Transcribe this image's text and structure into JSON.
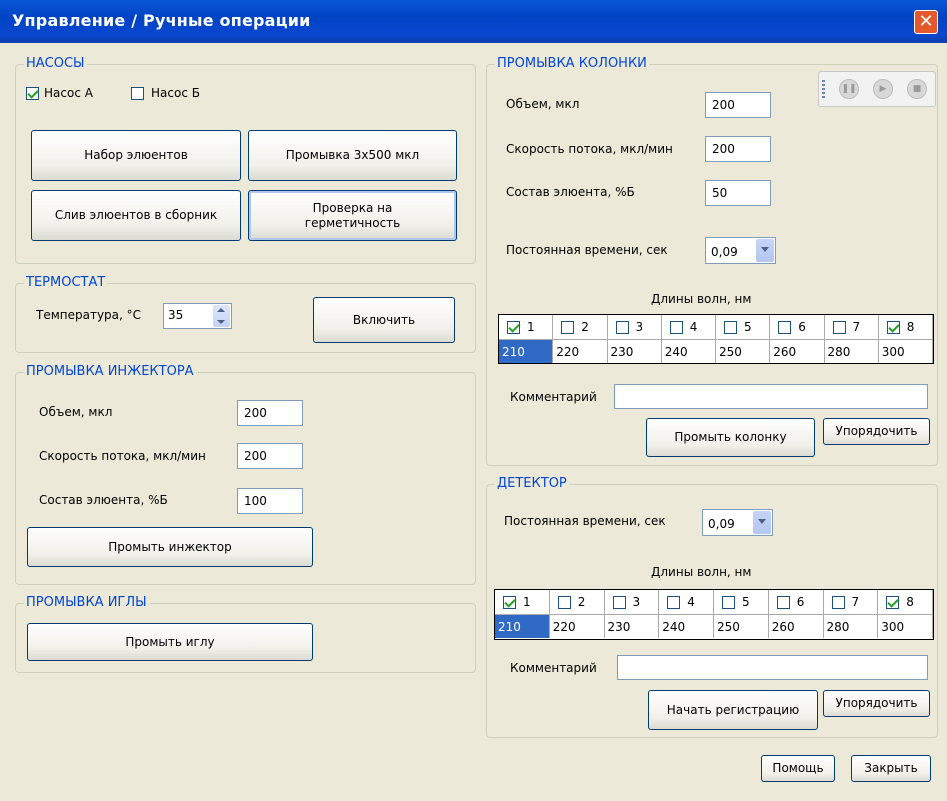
{
  "window": {
    "title": "Управление / Ручные операции"
  },
  "pumps": {
    "legend": "НАСОСЫ",
    "pump_a": {
      "label": "Насос А",
      "checked": true
    },
    "pump_b": {
      "label": "Насос Б",
      "checked": false
    },
    "btn_eluent_fill": "Набор элюентов",
    "btn_rinse": "Промывка 3х500 мкл",
    "btn_drain": "Слив элюентов в сборник",
    "btn_leak_line1": "Проверка на",
    "btn_leak_line2": "герметичность"
  },
  "thermostat": {
    "legend": "ТЕРМОСТАТ",
    "temp_label": "Температура, °С",
    "temp_value": "35",
    "btn_enable": "Включить"
  },
  "injector_wash": {
    "legend": "ПРОМЫВКА ИНЖЕКТОРА",
    "volume_label": "Объем, мкл",
    "volume_value": "200",
    "flow_label": "Скорость потока, мкл/мин",
    "flow_value": "200",
    "comp_label": "Состав элюента, %Б",
    "comp_value": "100",
    "btn": "Промыть инжектор"
  },
  "needle_wash": {
    "legend": "ПРОМЫВКА ИГЛЫ",
    "btn": "Промыть иглу"
  },
  "column_wash": {
    "legend": "ПРОМЫВКА КОЛОНКИ",
    "volume_label": "Объем, мкл",
    "volume_value": "200",
    "flow_label": "Скорость потока, мкл/мин",
    "flow_value": "200",
    "comp_label": "Состав элюента, %Б",
    "comp_value": "50",
    "tc_label": "Постоянная времени, сек",
    "tc_value": "0,09",
    "wl_title": "Длины волн, нм",
    "channels": [
      {
        "n": "1",
        "checked": true,
        "wl": "210"
      },
      {
        "n": "2",
        "checked": false,
        "wl": "220"
      },
      {
        "n": "3",
        "checked": false,
        "wl": "230"
      },
      {
        "n": "4",
        "checked": false,
        "wl": "240"
      },
      {
        "n": "5",
        "checked": false,
        "wl": "250"
      },
      {
        "n": "6",
        "checked": false,
        "wl": "260"
      },
      {
        "n": "7",
        "checked": false,
        "wl": "280"
      },
      {
        "n": "8",
        "checked": true,
        "wl": "300"
      }
    ],
    "comment_label": "Комментарий",
    "comment_value": "",
    "btn_wash": "Промыть колонку",
    "btn_sort": "Упорядочить"
  },
  "detector": {
    "legend": "ДЕТЕКТОР",
    "tc_label": "Постоянная времени, сек",
    "tc_value": "0,09",
    "wl_title": "Длины волн, нм",
    "channels": [
      {
        "n": "1",
        "checked": true,
        "wl": "210"
      },
      {
        "n": "2",
        "checked": false,
        "wl": "220"
      },
      {
        "n": "3",
        "checked": false,
        "wl": "230"
      },
      {
        "n": "4",
        "checked": false,
        "wl": "240"
      },
      {
        "n": "5",
        "checked": false,
        "wl": "250"
      },
      {
        "n": "6",
        "checked": false,
        "wl": "260"
      },
      {
        "n": "7",
        "checked": false,
        "wl": "280"
      },
      {
        "n": "8",
        "checked": true,
        "wl": "300"
      }
    ],
    "comment_label": "Комментарий",
    "comment_value": "",
    "btn_start": "Начать регистрацию",
    "btn_sort": "Упорядочить"
  },
  "footer": {
    "help": "Помощь",
    "close": "Закрыть"
  },
  "toolbar": {
    "icons": [
      "pause-icon",
      "play-icon",
      "stop-icon"
    ]
  },
  "colors": {
    "title_bar": "#0a58d6",
    "legend": "#0046d5",
    "selection": "#316ac5",
    "close_button": "#e4582b"
  }
}
